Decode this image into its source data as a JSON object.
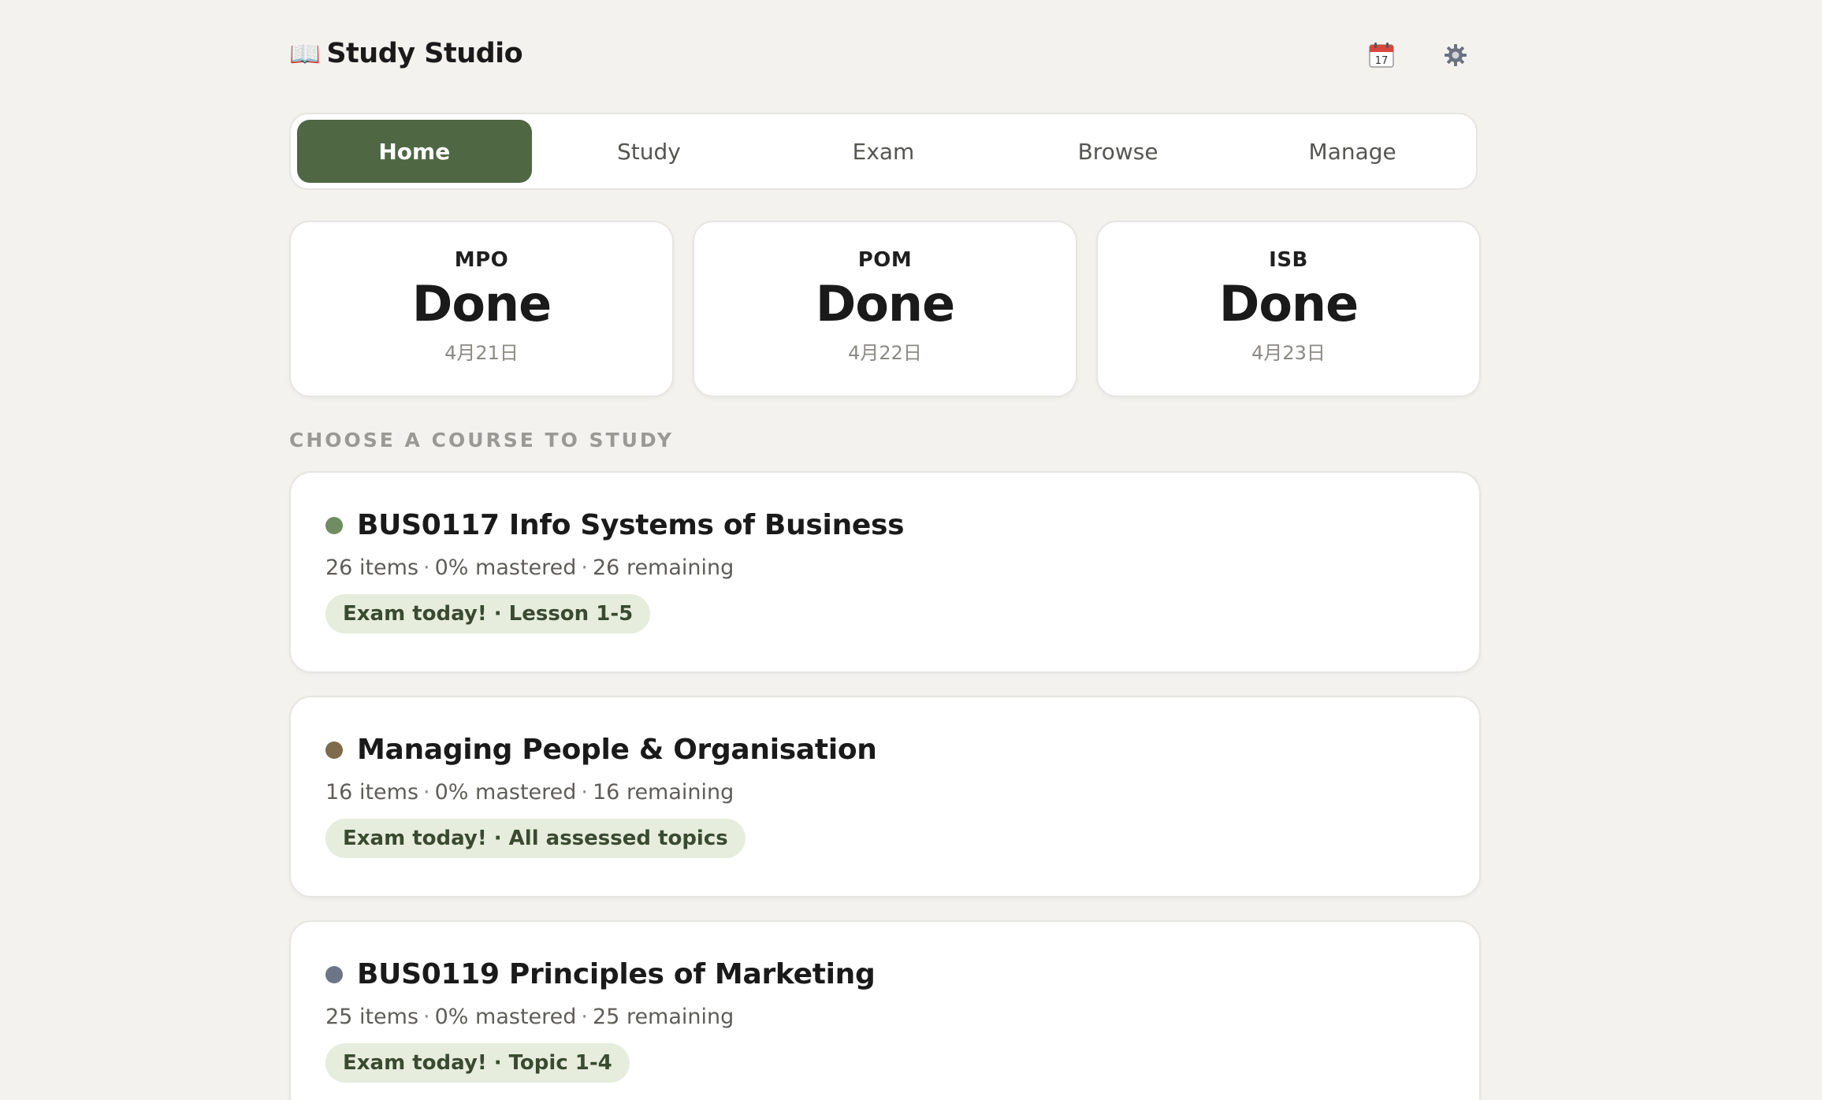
{
  "app": {
    "title": "Study Studio",
    "brand_icon": "open-book-icon"
  },
  "header": {
    "calendar_day": "17",
    "calendar_icon": "calendar-icon",
    "settings_icon": "gear-icon"
  },
  "nav": {
    "tabs": [
      {
        "label": "Home",
        "active": true
      },
      {
        "label": "Study",
        "active": false
      },
      {
        "label": "Exam",
        "active": false
      },
      {
        "label": "Browse",
        "active": false
      },
      {
        "label": "Manage",
        "active": false
      }
    ]
  },
  "summary": [
    {
      "code": "MPO",
      "status": "Done",
      "date": "4月21日"
    },
    {
      "code": "POM",
      "status": "Done",
      "date": "4月22日"
    },
    {
      "code": "ISB",
      "status": "Done",
      "date": "4月23日"
    }
  ],
  "section_label": "CHOOSE A COURSE TO STUDY",
  "courses": [
    {
      "title": "BUS0117 Info Systems of Business",
      "dot_color": "#6f8d60",
      "items": "26 items",
      "mastered": "0% mastered",
      "remaining": "26 remaining",
      "badge": "Exam today! · Lesson 1-5"
    },
    {
      "title": "Managing People & Organisation",
      "dot_color": "#7e6a4c",
      "items": "16 items",
      "mastered": "0% mastered",
      "remaining": "16 remaining",
      "badge": "Exam today! · All assessed topics"
    },
    {
      "title": "BUS0119 Principles of Marketing",
      "dot_color": "#6b7585",
      "items": "25 items",
      "mastered": "0% mastered",
      "remaining": "25 remaining",
      "badge": "Exam today! · Topic 1-4"
    }
  ],
  "colors": {
    "accent": "#4f6743",
    "background": "#f3f2ef",
    "badge_bg": "#e6eddd"
  }
}
